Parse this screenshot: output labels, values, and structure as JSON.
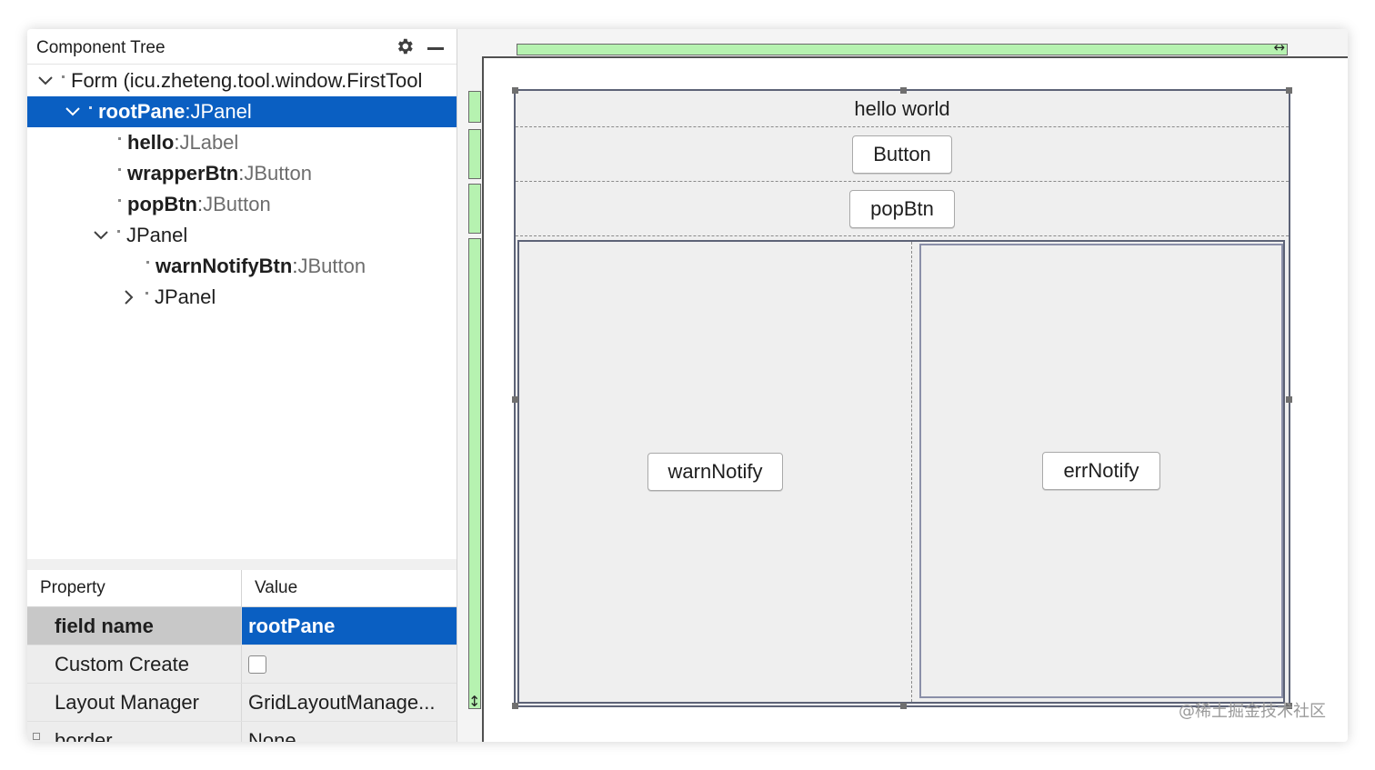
{
  "component_tree": {
    "title": "Component Tree",
    "nodes": [
      {
        "name": "",
        "separator": "",
        "type": "Form (icu.zheteng.tool.window.FirstTool",
        "expanded": true
      },
      {
        "name": "rootPane",
        "separator": " : ",
        "type": "JPanel",
        "expanded": true,
        "selected": true
      },
      {
        "name": "hello",
        "separator": " : ",
        "type": "JLabel"
      },
      {
        "name": "wrapperBtn",
        "separator": " : ",
        "type": "JButton"
      },
      {
        "name": "popBtn",
        "separator": " : ",
        "type": "JButton"
      },
      {
        "name": "",
        "separator": "",
        "type": "JPanel",
        "expanded": true
      },
      {
        "name": "warnNotifyBtn",
        "separator": " : ",
        "type": "JButton"
      },
      {
        "name": "",
        "separator": "",
        "type": "JPanel",
        "expanded": false
      }
    ]
  },
  "properties": {
    "header_property": "Property",
    "header_value": "Value",
    "rows": [
      {
        "key": "field name",
        "value": "rootPane"
      },
      {
        "key": "Custom Create",
        "value": ""
      },
      {
        "key": "Layout Manager",
        "value": "GridLayoutManage..."
      },
      {
        "key": "border",
        "value": "None"
      }
    ]
  },
  "designer": {
    "hello_label": "hello world",
    "button_label": "Button",
    "pop_button_label": "popBtn",
    "warn_button_label": "warnNotify",
    "err_button_label": "errNotify"
  },
  "watermark": "@稀土掘金技术社区",
  "colors": {
    "selection": "#0a5fc2",
    "ruler": "#b6f2b0",
    "tab_indicator": "#3574f0"
  },
  "icons": [
    "gear-icon",
    "minimize-icon",
    "chevron-down-icon",
    "chevron-right-icon",
    "resize-horizontal-icon",
    "resize-vertical-icon"
  ]
}
